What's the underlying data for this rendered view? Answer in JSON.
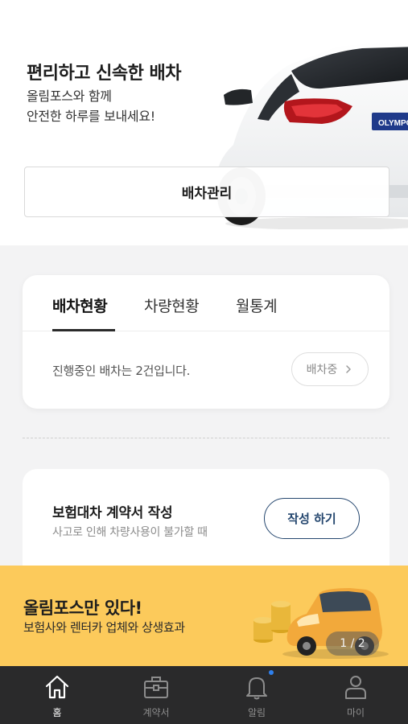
{
  "hero": {
    "title": "편리하고 신속한 배차",
    "subtitle_line1": "올림포스와 함께",
    "subtitle_line2": "안전한 하루를 보내세요!",
    "plate_text": "OLYMPO",
    "dispatch_button": "배차관리"
  },
  "status_card": {
    "tabs": [
      {
        "label": "배차현황",
        "active": true
      },
      {
        "label": "차량현황",
        "active": false
      },
      {
        "label": "월통계",
        "active": false
      }
    ],
    "message": "진행중인 배차는 2건입니다.",
    "status_button": "배차중"
  },
  "contract_card": {
    "title": "보험대차 계약서 작성",
    "subtitle": "사고로 인해 차량사용이 불가할 때",
    "button": "작성 하기"
  },
  "banner": {
    "title": "올림포스만 있다!",
    "subtitle": "보험사와 렌터카 업체와 상생효과",
    "page_indicator": "1 / 2",
    "background_color": "#fcca5b"
  },
  "bottom_nav": {
    "items": [
      {
        "label": "홈",
        "icon": "home-icon",
        "active": true
      },
      {
        "label": "계약서",
        "icon": "briefcase-icon",
        "active": false
      },
      {
        "label": "알림",
        "icon": "bell-icon",
        "active": false,
        "has_badge": true
      },
      {
        "label": "마이",
        "icon": "person-icon",
        "active": false
      }
    ]
  },
  "colors": {
    "accent_navy": "#25476f",
    "nav_background": "#2a2a2b",
    "badge_blue": "#2f80ed"
  }
}
